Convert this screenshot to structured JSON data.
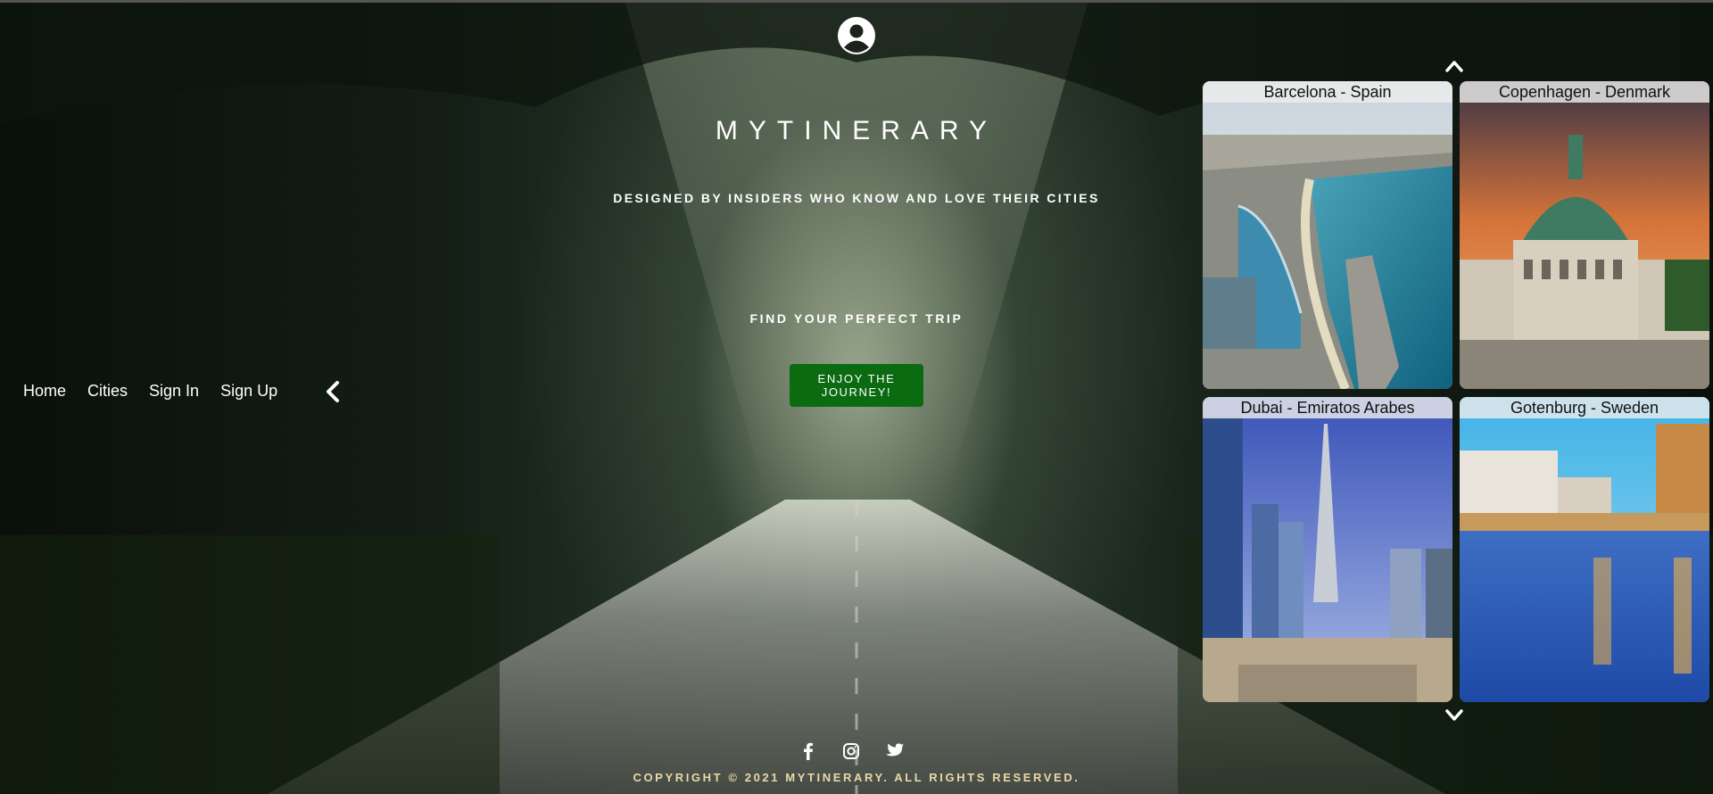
{
  "brand": {
    "title": "MYTINERARY",
    "tagline": "DESIGNED BY INSIDERS WHO KNOW AND LOVE THEIR CITIES"
  },
  "hero": {
    "headline": "FIND YOUR PERFECT TRIP",
    "cta_label": "ENJOY THE JOURNEY!"
  },
  "nav": {
    "items": [
      "Home",
      "Cities",
      "Sign In",
      "Sign Up"
    ]
  },
  "carousel": {
    "cities": [
      {
        "label": "Barcelona - Spain"
      },
      {
        "label": "Copenhagen - Denmark"
      },
      {
        "label": "Dubai - Emiratos Arabes"
      },
      {
        "label": "Gotenburg - Sweden"
      }
    ]
  },
  "footer": {
    "copyright": "COPYRIGHT © 2021 MYTINERARY. ALL RIGHTS RESERVED."
  },
  "icons": {
    "user": "user-circle-icon",
    "nav_toggle": "chevron-left-icon",
    "carousel_prev": "chevron-up-icon",
    "carousel_next": "chevron-down-icon",
    "social": [
      "facebook-icon",
      "instagram-icon",
      "twitter-icon"
    ]
  },
  "colors": {
    "cta": "#0a6b10",
    "copyright": "#e9d9a8"
  }
}
